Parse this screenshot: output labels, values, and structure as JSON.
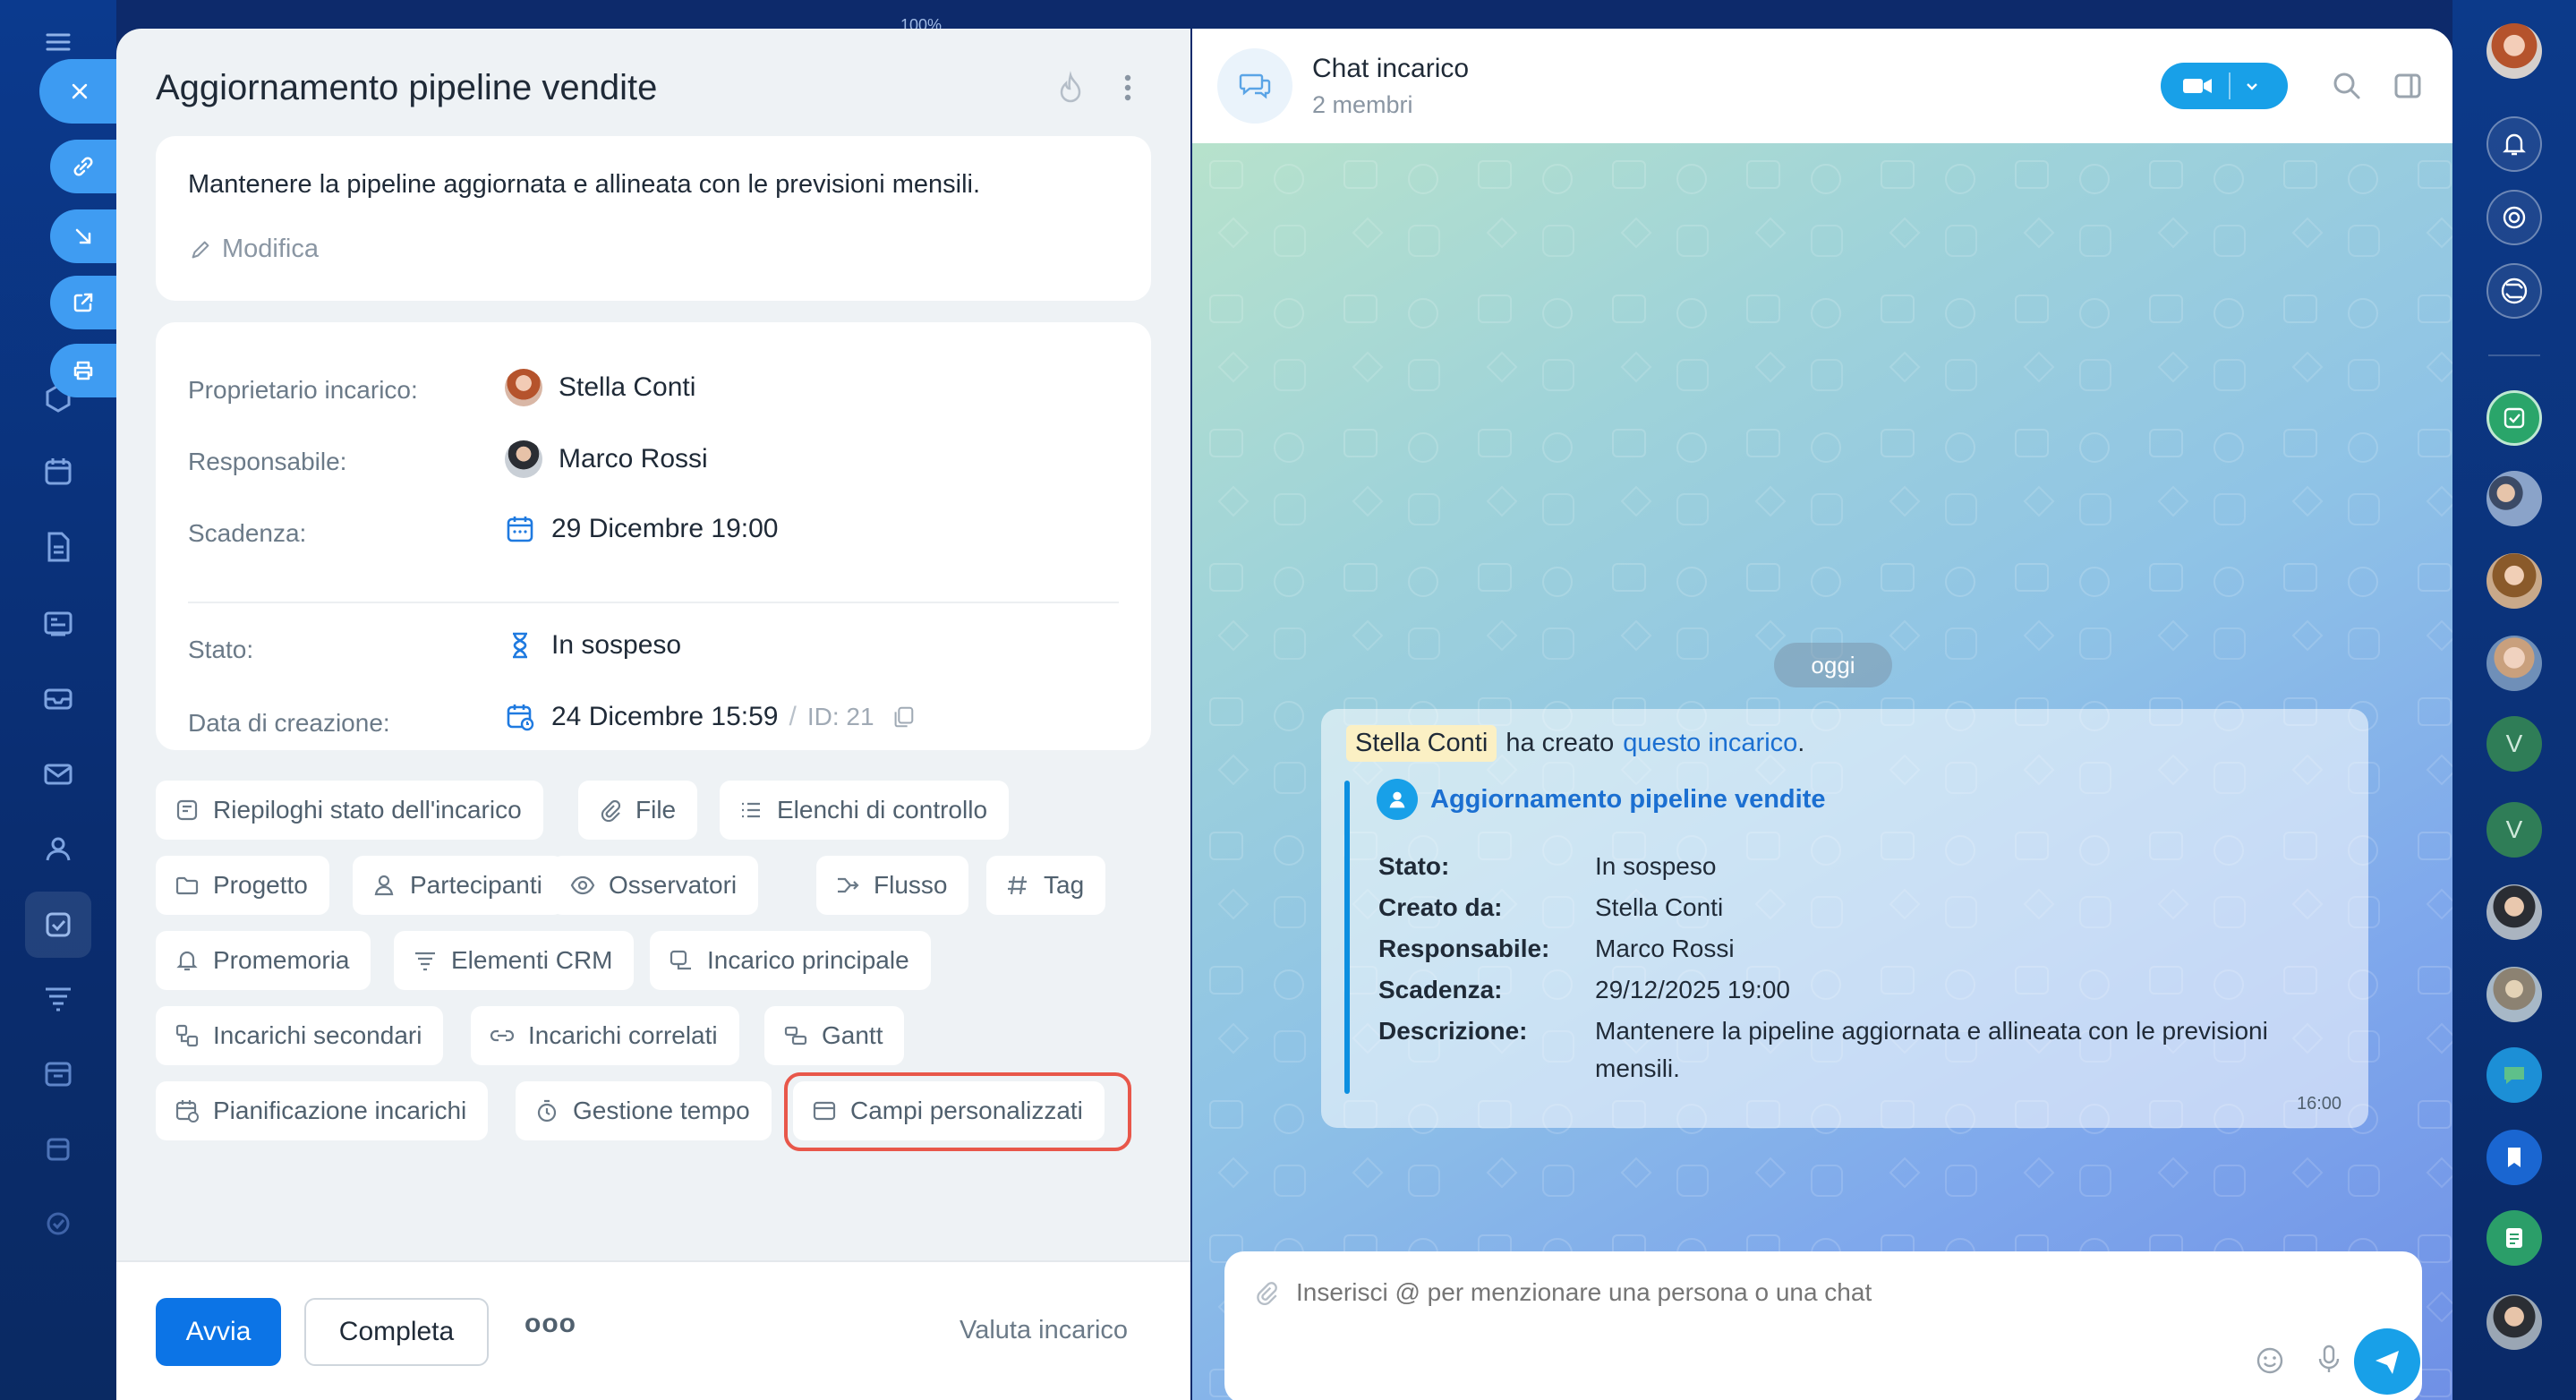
{
  "top_zoom": "100%",
  "task": {
    "title": "Aggiornamento pipeline vendite",
    "description": "Mantenere la pipeline aggiornata e allineata con le previsioni mensili.",
    "edit_label": "Modifica",
    "fields": {
      "owner_label": "Proprietario incarico:",
      "owner_value": "Stella Conti",
      "responsible_label": "Responsabile:",
      "responsible_value": "Marco Rossi",
      "deadline_label": "Scadenza:",
      "deadline_value": "29 Dicembre 19:00",
      "status_label": "Stato:",
      "status_value": "In sospeso",
      "created_label": "Data di creazione:",
      "created_value": "24 Dicembre 15:59",
      "id_sep": "/",
      "id_value": "ID: 21"
    },
    "chips": [
      "Riepiloghi stato dell'incarico",
      "File",
      "Elenchi di controllo",
      "Progetto",
      "Partecipanti",
      "Osservatori",
      "Flusso",
      "Tag",
      "Promemoria",
      "Elementi CRM",
      "Incarico principale",
      "Incarichi secondari",
      "Incarichi correlati",
      "Gantt",
      "Pianificazione incarichi",
      "Gestione tempo",
      "Campi personalizzati"
    ],
    "footer": {
      "start": "Avvia",
      "complete": "Completa",
      "more": "ooo",
      "rate": "Valuta incarico"
    }
  },
  "chat": {
    "title": "Chat incarico",
    "members": "2 membri",
    "date_pill": "oggi",
    "message": {
      "author": "Stella Conti",
      "text_mid": "ha creato",
      "link": "questo incarico",
      "link_end": ".",
      "task_title": "Aggiornamento pipeline vendite",
      "details": [
        {
          "label": "Stato:",
          "value": "In sospeso"
        },
        {
          "label": "Creato da:",
          "value": "Stella Conti"
        },
        {
          "label": "Responsabile:",
          "value": "Marco Rossi"
        },
        {
          "label": "Scadenza:",
          "value": "29/12/2025 19:00"
        },
        {
          "label": "Descrizione:",
          "value": "Mantenere la pipeline aggiornata e allineata con le previsioni"
        },
        {
          "label": "",
          "value": "mensili."
        }
      ],
      "time": "16:00"
    },
    "input_placeholder": "Inserisci @ per menzionare una persona o una chat"
  },
  "rightbar": {
    "initials_1": "V",
    "initials_2": "V"
  },
  "colors": {
    "accent": "#0c74e6",
    "highlight_border": "#e8574a",
    "link": "#1b6fd1"
  }
}
